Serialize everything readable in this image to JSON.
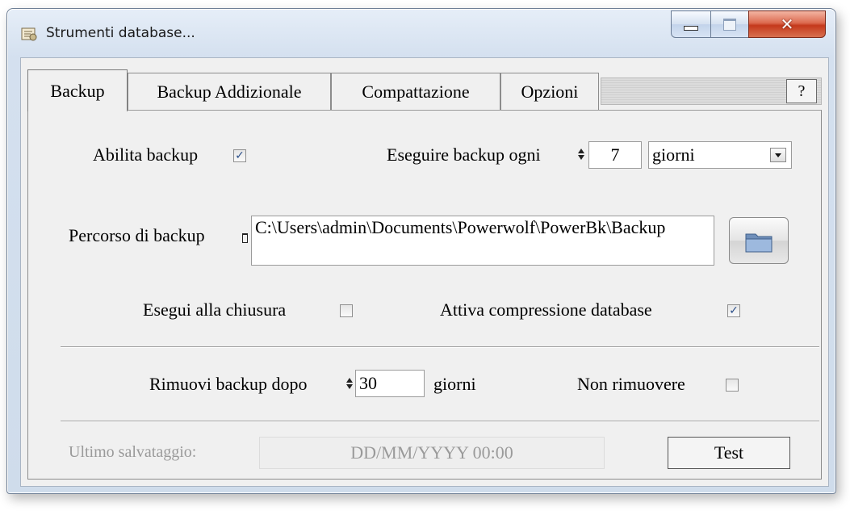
{
  "window": {
    "title": "Strumenti database..."
  },
  "tabs": [
    "Backup",
    "Backup Addizionale",
    "Compattazione",
    "Opzioni"
  ],
  "help_label": "?",
  "backup": {
    "enable_label": "Abilita backup",
    "enable_checked": true,
    "every_label": "Eseguire backup ogni",
    "every_value": "7",
    "every_unit": "giorni",
    "path_label": "Percorso di backup",
    "path_value": "C:\\Users\\admin\\Documents\\Powerwolf\\PowerBk\\Backup",
    "run_on_close_label": "Esegui alla chiusura",
    "run_on_close_checked": false,
    "compression_label": "Attiva compressione database",
    "compression_checked": true,
    "remove_after_label": "Rimuovi backup dopo",
    "remove_after_value": "30",
    "remove_after_unit": "giorni",
    "no_remove_label": "Non rimuovere",
    "no_remove_checked": false,
    "last_save_label": "Ultimo salvataggio:",
    "last_save_value": "DD/MM/YYYY 00:00",
    "test_label": "Test"
  },
  "icons": {
    "app": "database-tools-icon",
    "browse": "folder-icon"
  },
  "colors": {
    "accent_check": "#2b4f8a",
    "close_button": "#c4391c",
    "disabled_text": "#9a9a9a"
  }
}
